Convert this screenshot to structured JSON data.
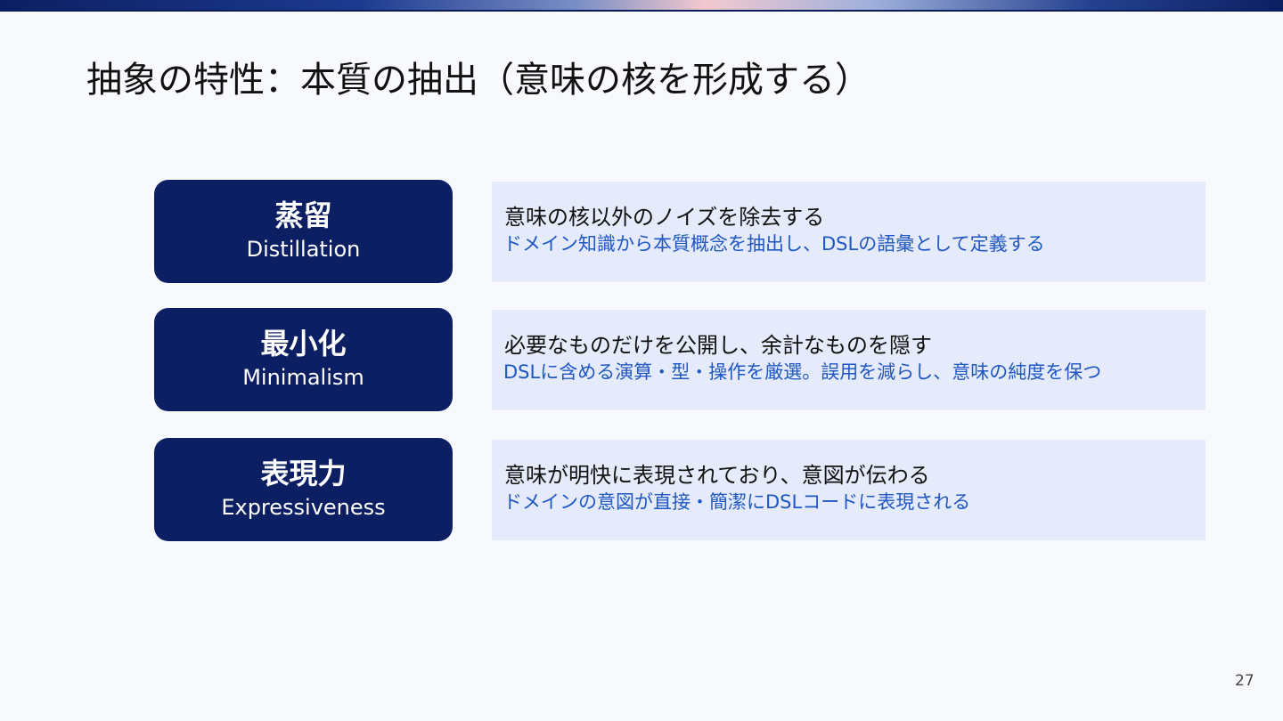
{
  "slide": {
    "title": "抽象の特性：本質の抽出（意味の核を形成する）",
    "page_number": "27"
  },
  "rows": [
    {
      "label_jp": "蒸留",
      "label_en": "Distillation",
      "main": "意味の核以外のノイズを除去する",
      "sub": "ドメイン知識から本質概念を抽出し、DSLの語彙として定義する"
    },
    {
      "label_jp": "最小化",
      "label_en": "Minimalism",
      "main": "必要なものだけを公開し、余計なものを隠す",
      "sub": "DSLに含める演算・型・操作を厳選。誤用を減らし、意味の純度を保つ"
    },
    {
      "label_jp": "表現力",
      "label_en": "Expressiveness",
      "main": "意味が明快に表現されており、意図が伝わる",
      "sub": "ドメインの意図が直接・簡潔にDSLコードに表現される"
    }
  ],
  "colors": {
    "label_box": "#0c1f62",
    "desc_box": "#e5ebfa",
    "sub_text": "#1f57c3",
    "background": "#f7f9fc"
  }
}
